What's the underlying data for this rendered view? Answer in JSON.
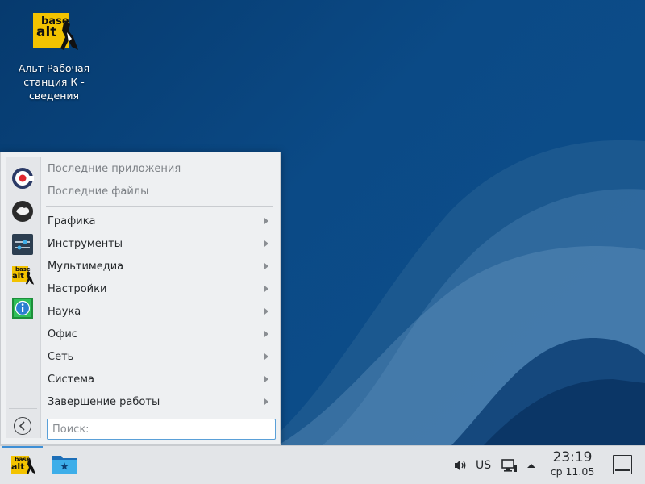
{
  "desktop": {
    "icon": {
      "logo_text_top": "base",
      "logo_text_bottom": "alt",
      "caption_line1": "Альт Рабочая",
      "caption_line2": "станция К  -",
      "caption_line3": "сведения"
    }
  },
  "menu": {
    "recent": [
      {
        "label": "Последние приложения"
      },
      {
        "label": "Последние файлы"
      }
    ],
    "categories": [
      {
        "label": "Графика"
      },
      {
        "label": "Инструменты"
      },
      {
        "label": "Мультимедиа"
      },
      {
        "label": "Настройки"
      },
      {
        "label": "Наука"
      },
      {
        "label": "Офис"
      },
      {
        "label": "Сеть"
      },
      {
        "label": "Система"
      },
      {
        "label": "Завершение работы"
      }
    ],
    "search_placeholder": "Поиск:",
    "favorites": [
      "app-c-icon",
      "weather-icon",
      "settings-sliders-icon",
      "basealt-icon",
      "info-icon"
    ]
  },
  "taskbar": {
    "keyboard_layout": "US",
    "clock_time": "23:19",
    "clock_date": "ср 11.05"
  },
  "colors": {
    "desktop_bg": "#0b4a86",
    "menu_bg": "#eef0f2",
    "taskbar_bg": "#e3e5e8",
    "accent": "#3d8fd6",
    "logo_yellow": "#f3c300"
  }
}
